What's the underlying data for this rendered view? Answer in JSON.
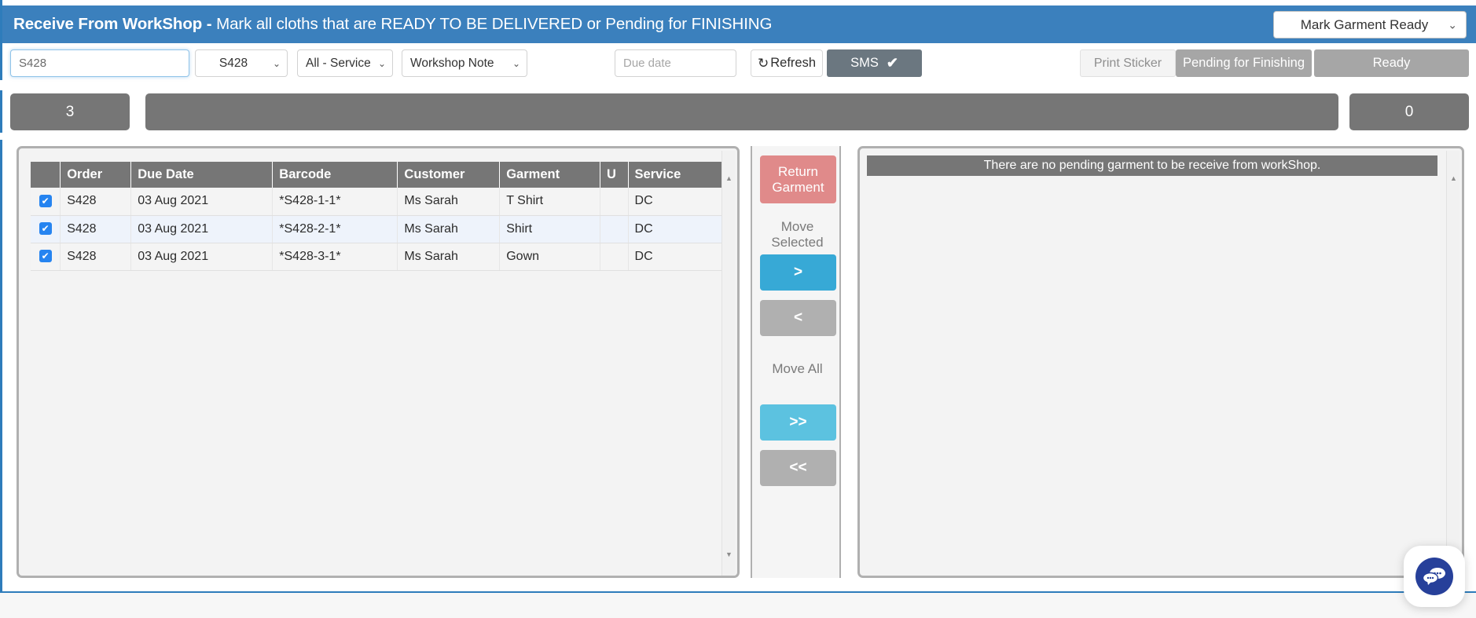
{
  "header": {
    "title_bold": "Receive From WorkShop -",
    "title_rest": " Mark all cloths that are READY TO BE DELIVERED or Pending for FINISHING",
    "action_select_value": "Mark Garment Ready",
    "chevron": "⌄",
    "bg_color": "#3b80bd"
  },
  "toolbar": {
    "search_value": "S428",
    "search_placeholder": "",
    "order_select_value": "S428",
    "service_select_value": "All - Service",
    "note_select_value": "Workshop Note",
    "due_date_placeholder": "Due date",
    "refresh_label": "Refresh",
    "refresh_icon": "↺",
    "sms_label": "SMS",
    "sms_check": "✔",
    "print_sticker_label": "Print Sticker",
    "pending_for_finishing_label": "Pending for Finishing",
    "ready_label": "Ready"
  },
  "counters": {
    "left_count": "3",
    "middle_count": "",
    "right_count": "0"
  },
  "grid": {
    "columns": [
      "",
      "Order",
      "Due Date",
      "Barcode",
      "Customer",
      "Garment",
      "U",
      "Service"
    ],
    "rows": [
      {
        "checked": "✔",
        "order": "S428",
        "due_date": "03 Aug 2021",
        "barcode": "*S428-1-1*",
        "customer": "Ms Sarah",
        "garment": "T Shirt",
        "u": "",
        "service": "DC"
      },
      {
        "checked": "✔",
        "order": "S428",
        "due_date": "03 Aug 2021",
        "barcode": "*S428-2-1*",
        "customer": "Ms Sarah",
        "garment": "Shirt",
        "u": "",
        "service": "DC"
      },
      {
        "checked": "✔",
        "order": "S428",
        "due_date": "03 Aug 2021",
        "barcode": "*S428-3-1*",
        "customer": "Ms Sarah",
        "garment": "Gown",
        "u": "",
        "service": "DC"
      }
    ],
    "scroll_up_arrow": "▲",
    "scroll_down_arrow": "▼"
  },
  "transfer": {
    "return_garment_line1": "Return",
    "return_garment_line2": "Garment",
    "move_selected_line1": "Move",
    "move_selected_line2": "Selected",
    "move_right": ">",
    "move_left": "<",
    "move_all_label": "Move All",
    "move_all_right": ">>",
    "move_all_left": "<<",
    "return_color": "#e08a8a",
    "active_color": "#37a9d6",
    "inactive_color": "#b0b0b0"
  },
  "right_panel": {
    "empty_message": "There are no pending garment to be receive from workShop.",
    "scroll_up_arrow": "▲"
  },
  "chat": {
    "icon_name": "chat-bubbles-icon",
    "color": "#27409a"
  }
}
